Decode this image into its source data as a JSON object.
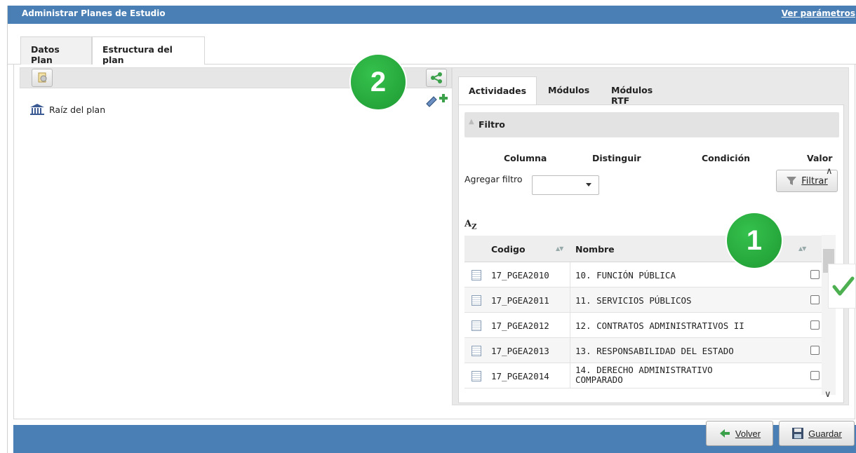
{
  "window": {
    "title": "Administrar Planes de Estudio",
    "params_link": "Ver parámetros"
  },
  "tabs": [
    {
      "label": "Datos Plan"
    },
    {
      "label": "Estructura del plan"
    }
  ],
  "tree": {
    "root_label": "Raíz del plan"
  },
  "right_tabs": [
    {
      "label": "Actividades"
    },
    {
      "label": "Módulos"
    },
    {
      "label": "Módulos RTF"
    }
  ],
  "filter": {
    "title": "Filtro",
    "columns": [
      "Columna",
      "Distinguir",
      "Condición",
      "Valor"
    ],
    "add_label": "Agregar filtro",
    "select_value": "",
    "button": "Filtrar"
  },
  "grid": {
    "sort_icon": "A",
    "sort_icon_sub": "Z",
    "headers": {
      "code": "Codigo",
      "name": "Nombre"
    },
    "rows": [
      {
        "code": "17_PGEA2010",
        "name": "10. FUNCIÓN PÚBLICA",
        "name2": ""
      },
      {
        "code": "17_PGEA2011",
        "name": "11. SERVICIOS PÚBLICOS",
        "name2": ""
      },
      {
        "code": "17_PGEA2012",
        "name": "12. CONTRATOS ADMINISTRATIVOS II",
        "name2": ""
      },
      {
        "code": "17_PGEA2013",
        "name": "13. RESPONSABILIDAD DEL ESTADO",
        "name2": ""
      },
      {
        "code": "17_PGEA2014",
        "name": "14. DERECHO ADMINISTRATIVO",
        "name2": "COMPARADO"
      }
    ]
  },
  "badges": {
    "one": "1",
    "two": "2"
  },
  "footer": {
    "back": "Volver",
    "save": "Guardar"
  },
  "colors": {
    "title_bar": "#4a7fb5",
    "badge_green": "#26a83a",
    "check_green": "#4caf50"
  },
  "icons": {
    "copy": "gear-doc-icon",
    "share": "share-icon",
    "add": "pencil-add-icon",
    "funnel": "funnel-icon",
    "back": "back-arrow-icon",
    "save": "floppy-icon"
  }
}
